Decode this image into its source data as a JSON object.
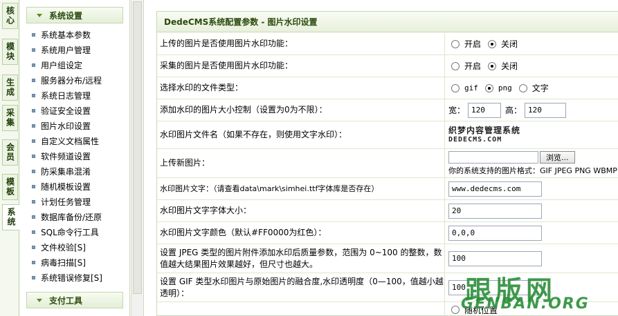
{
  "vtabs": [
    "核心",
    "模块",
    "生成",
    "采集",
    "会员",
    "模板",
    "系统"
  ],
  "menu": {
    "section1": "系统设置",
    "items": [
      "系统基本参数",
      "系统用户管理",
      "用户组设定",
      "服务器分布/远程",
      "系统日志管理",
      "验证安全设置",
      "图片水印设置",
      "自定义文档属性",
      "软件频道设置",
      "防采集串混淆",
      "随机模板设置",
      "计划任务管理",
      "数据库备份/还原",
      "SQL命令行工具",
      "文件校验[S]",
      "病毒扫描[S]",
      "系统错误修复[S]"
    ],
    "section2": "支付工具"
  },
  "main": {
    "title": "DedeCMS系统配置参数 - 图片水印设置",
    "rows": {
      "upload_wm": {
        "label": "上传的图片是否使用图片水印功能：",
        "opt_on": "开启",
        "opt_off": "关闭"
      },
      "collect_wm": {
        "label": "采集的图片是否使用图片水印功能：",
        "opt_on": "开启",
        "opt_off": "关闭"
      },
      "wm_type": {
        "label": "选择水印的文件类型：",
        "opts": [
          "gif",
          "png",
          "文字"
        ]
      },
      "size_ctrl": {
        "label": "添加水印的图片大小控制（设置为0为不限）：",
        "width_label": "宽：",
        "width_value": "120",
        "height_label": "高：",
        "height_value": "120"
      },
      "wm_file": {
        "label": "水印图片文件名（如果不存在，则使用文字水印）：",
        "logo_line1": "织梦内容管理系统",
        "logo_line2": "DEDECMS.COM"
      },
      "upload_new": {
        "label": "上传新图片：",
        "browse_label": "浏览...",
        "formats_note": "你的系统支持的图片格式：GIF JPEG PNG WBMP"
      },
      "wm_text": {
        "label": "水印图片文字：（请查看data\\mark\\simhei.ttf字体库是否存在）",
        "value": "www.dedecms.com"
      },
      "font_size": {
        "label": "水印图片文字字体大小：",
        "value": "20"
      },
      "font_color": {
        "label": "水印图片文字颜色（默认#FF0000为红色）：",
        "value": "0,0,0"
      },
      "jpeg_quality": {
        "label": "设置 JPEG 类型的图片附件添加水印后质量参数，范围为 0~100 的整数，数值越大结果图片效果越好，但尺寸也越大。",
        "value": "100"
      },
      "gif_alpha": {
        "label": "设置 GIF 类型水印图片与原始图片的融合度,水印透明度（0—100，值越小越透明）：",
        "value": "100"
      },
      "position": {
        "opt_random": "随机位置"
      }
    }
  },
  "site_watermark": {
    "cn": "跟版网",
    "en": "GENBAN.ORG"
  }
}
